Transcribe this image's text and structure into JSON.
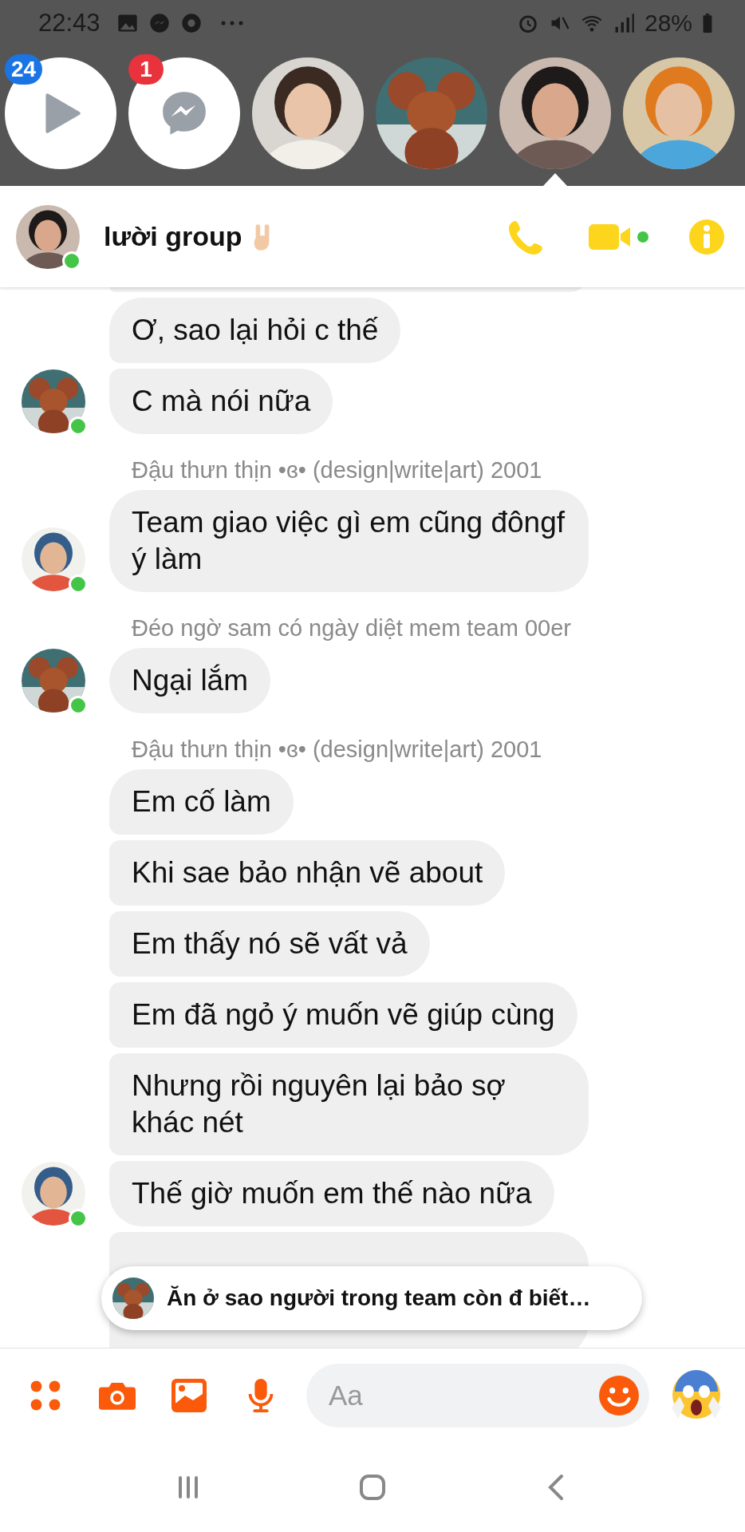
{
  "status_bar": {
    "time": "22:43",
    "battery": "28%"
  },
  "chat_heads": [
    {
      "kind": "video",
      "badge": "24",
      "color": "#1b74e4",
      "selected": false
    },
    {
      "kind": "messenger",
      "badge": "1",
      "color": "#e8323c",
      "selected": false
    },
    {
      "kind": "picture",
      "selected": false
    },
    {
      "kind": "picture",
      "selected": false
    },
    {
      "kind": "picture",
      "selected": true
    },
    {
      "kind": "picture",
      "selected": false
    }
  ],
  "header": {
    "title": "lười group",
    "online": true
  },
  "messages": [
    {
      "kind": "clipped"
    },
    {
      "kind": "bubble",
      "text": "Ơ, sao lại hỏi c thế"
    },
    {
      "kind": "bubble",
      "text": "C mà nói nữa",
      "avatar": {
        "kind": "picture"
      },
      "online": true
    },
    {
      "kind": "sender",
      "text": "Đậu thưn thịn •ɞ•  (design|write|art) 2001"
    },
    {
      "kind": "bubble",
      "text": "Team giao việc gì em cũng đôngf ý làm",
      "avatar": {
        "kind": "picture"
      },
      "online": true
    },
    {
      "kind": "sender",
      "text": "Đéo ngờ sam có ngày diệt mem team 00er"
    },
    {
      "kind": "bubble",
      "text": "Ngại lắm",
      "avatar": {
        "kind": "picture"
      },
      "online": true
    },
    {
      "kind": "sender",
      "text": "Đậu thưn thịn •ɞ•  (design|write|art) 2001"
    },
    {
      "kind": "bubble",
      "text": "Em cố làm"
    },
    {
      "kind": "bubble",
      "text": "Khi sae bảo nhận vẽ about"
    },
    {
      "kind": "bubble",
      "text": "Em thấy nó sẽ vất vả"
    },
    {
      "kind": "bubble",
      "text": "Em đã ngỏ ý muốn vẽ giúp cùng"
    },
    {
      "kind": "bubble",
      "text": "Nhưng rồi nguyên lại bảo sợ khác nét"
    },
    {
      "kind": "bubble",
      "text": "Thế giờ muốn em thế nào nữa",
      "avatar": {
        "kind": "picture"
      },
      "online": true
    },
    {
      "kind": "clipped"
    }
  ],
  "notification": {
    "avatar": {
      "kind": "picture"
    },
    "text": "Ăn ở sao người trong team còn đ biết…"
  },
  "composer": {
    "placeholder": "Aa"
  }
}
